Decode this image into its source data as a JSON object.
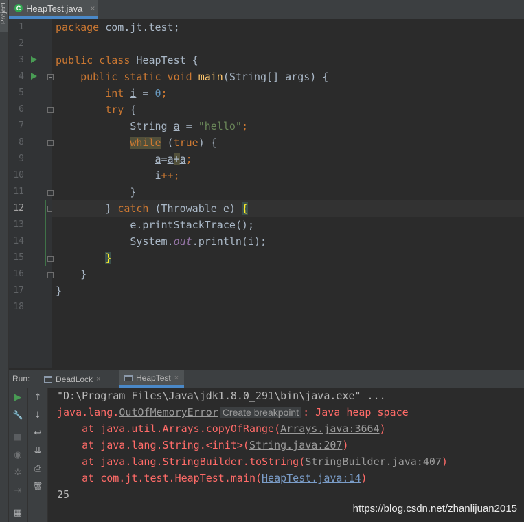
{
  "side_tool": {
    "project_label": "Project"
  },
  "editor_tab": {
    "filename": "HeapTest.java",
    "close": "×"
  },
  "line_numbers": [
    "1",
    "2",
    "3",
    "4",
    "5",
    "6",
    "7",
    "8",
    "9",
    "10",
    "11",
    "12",
    "13",
    "14",
    "15",
    "16",
    "17",
    "18"
  ],
  "code": {
    "l1": {
      "kw": "package",
      "rest": " com.jt.test;"
    },
    "l3": {
      "kw": "public class",
      "rest": " HeapTest {"
    },
    "l4": {
      "indent": "    ",
      "kw": "public static void",
      "name": "main",
      "rest": "(String[] args) {"
    },
    "l5": {
      "indent": "        ",
      "kw": "int",
      "sp": " ",
      "var": "i",
      "eq": " = ",
      "num": "0",
      "end": ";"
    },
    "l6": {
      "indent": "        ",
      "kw": "try",
      "rest": " {"
    },
    "l7": {
      "indent": "            ",
      "pre": "String ",
      "var": "a",
      "eq": " = ",
      "str": "\"hello\"",
      "end": ";"
    },
    "l8": {
      "indent": "            ",
      "kw": "while",
      "mid": " (",
      "kw2": "true",
      "rest": ") {"
    },
    "l9": {
      "indent": "                ",
      "v1": "a",
      "eq": "=",
      "v2": "a",
      "plus": "+",
      "v3": "a",
      "end": ";"
    },
    "l10": {
      "indent": "                ",
      "var": "i",
      "rest": "++;"
    },
    "l11": {
      "indent": "            ",
      "rest": "}"
    },
    "l12": {
      "indent": "        ",
      "pre": "} ",
      "kw": "catch",
      "rest": " (Throwable e) ",
      "brace": "{"
    },
    "l13": {
      "indent": "            ",
      "rest": "e.printStackTrace();"
    },
    "l14": {
      "indent": "            ",
      "pre": "System.",
      "field": "out",
      "mid": ".println(",
      "var": "i",
      "end": ");"
    },
    "l15": {
      "indent": "        ",
      "brace": "}"
    },
    "l16": {
      "indent": "    ",
      "rest": "}"
    },
    "l17": {
      "rest": "}"
    }
  },
  "run_panel": {
    "label": "Run:",
    "tabs": [
      {
        "label": "DeadLock",
        "close": "×"
      },
      {
        "label": "HeapTest",
        "close": "×"
      }
    ]
  },
  "toolbar_icons": {
    "rerun": "▶",
    "up": "↑",
    "settings": "🔧",
    "down": "↓",
    "stop": "■",
    "soft_wrap": "↩",
    "camera": "◉",
    "scroll_end": "⇊",
    "debug": "✲",
    "print": "⎙",
    "exit": "⇥",
    "delete": "🗑",
    "layout": "▦"
  },
  "console": {
    "cmd": "\"D:\\Program Files\\Java\\jdk1.8.0_291\\bin\\java.exe\" ...",
    "err_prefix": "java.lang.",
    "err_class": "OutOfMemoryError",
    "bp_hint": "Create breakpoint",
    "err_msg": ": Java heap space",
    "trace": [
      {
        "pre": "    at java.util.Arrays.copyOfRange(",
        "link": "Arrays.java:3664",
        "post": ")"
      },
      {
        "pre": "    at java.lang.String.<init>(",
        "link": "String.java:207",
        "post": ")"
      },
      {
        "pre": "    at java.lang.StringBuilder.toString(",
        "link": "StringBuilder.java:407",
        "post": ")"
      },
      {
        "pre": "    at com.jt.test.HeapTest.main(",
        "link": "HeapTest.java:14",
        "post": ")"
      }
    ],
    "output": "25"
  },
  "watermark": "https://blog.csdn.net/zhanlijuan2015",
  "colors": {
    "background": "#2b2b2b",
    "keyword": "#cc7832",
    "function": "#ffc66d",
    "number": "#6897bb",
    "string": "#6a8759",
    "error": "#ff6b68",
    "link": "#7a9cc7"
  }
}
